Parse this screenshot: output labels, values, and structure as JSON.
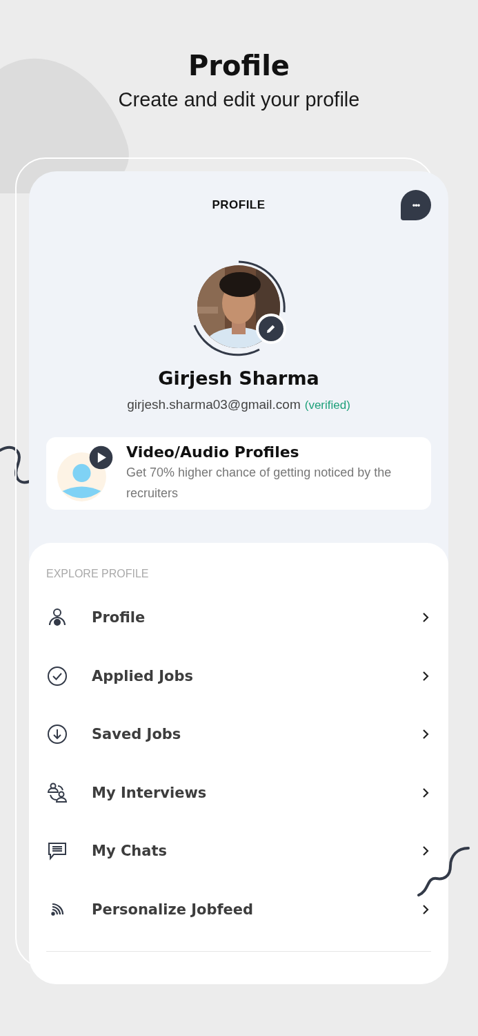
{
  "heading": {
    "title": "Profile",
    "subtitle": "Create and edit your profile"
  },
  "screen": {
    "title": "PROFILE",
    "chat_button": "•••"
  },
  "user": {
    "name": "Girjesh Sharma",
    "email": "girjesh.sharma03@gmail.com",
    "verified": "(verified)"
  },
  "promo": {
    "title": "Video/Audio Profiles",
    "text": "Get 70% higher chance of getting noticed by the recruiters"
  },
  "menu": {
    "section": "EXPLORE PROFILE",
    "items": [
      {
        "label": "Profile"
      },
      {
        "label": "Applied Jobs"
      },
      {
        "label": "Saved Jobs"
      },
      {
        "label": "My Interviews"
      },
      {
        "label": "My Chats"
      },
      {
        "label": "Personalize Jobfeed"
      }
    ]
  }
}
